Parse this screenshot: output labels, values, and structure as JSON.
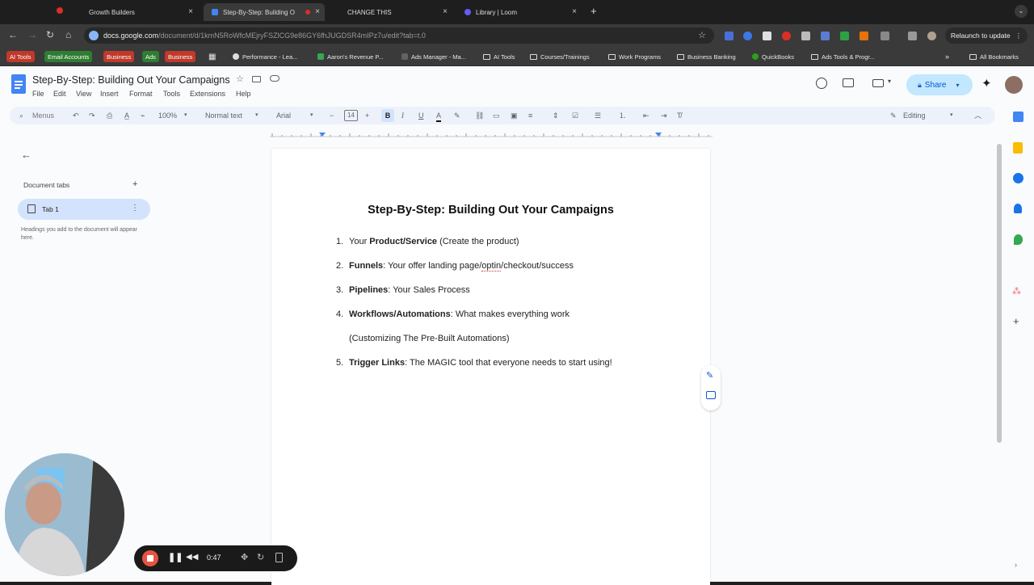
{
  "browser": {
    "tabs": [
      {
        "title": "Growth Builders",
        "active": false
      },
      {
        "title": "Step-By-Step: Building O",
        "active": true
      },
      {
        "title": "CHANGE THIS",
        "active": false
      },
      {
        "title": "Library | Loom",
        "active": false
      }
    ],
    "url_host": "docs.google.com",
    "url_path": "/document/d/1kmN5RoWfcMEjryFSZlCG9e86GY6fhJUGDSR4mIPz7u/edit?tab=t.0",
    "relaunch_label": "Relaunch to update",
    "bookmarks": [
      {
        "label": "AI Tools",
        "kind": "chip",
        "color": "#c0392b"
      },
      {
        "label": "Email Accounts",
        "kind": "chip",
        "color": "#2e7d32"
      },
      {
        "label": "Business",
        "kind": "chip",
        "color": "#c0392b"
      },
      {
        "label": "Ads",
        "kind": "chip",
        "color": "#2e7d32"
      },
      {
        "label": "Business",
        "kind": "chip",
        "color": "#c0392b"
      },
      {
        "label": "Performance - Lea...",
        "kind": "site"
      },
      {
        "label": "Aaron's Revenue P...",
        "kind": "site"
      },
      {
        "label": "Ads Manager - Ma...",
        "kind": "site"
      },
      {
        "label": "AI Tools",
        "kind": "folder"
      },
      {
        "label": "Courses/Trainings",
        "kind": "folder"
      },
      {
        "label": "Work Programs",
        "kind": "folder"
      },
      {
        "label": "Business Banking",
        "kind": "folder"
      },
      {
        "label": "QuickBooks",
        "kind": "site"
      },
      {
        "label": "Ads Tools & Progr...",
        "kind": "folder"
      },
      {
        "label": "All Bookmarks",
        "kind": "folder"
      }
    ]
  },
  "docs": {
    "title": "Step-By-Step:  Building Out Your Campaigns",
    "menu": [
      "File",
      "Edit",
      "View",
      "Insert",
      "Format",
      "Tools",
      "Extensions",
      "Help"
    ],
    "share_label": "Share",
    "editing_label": "Editing",
    "toolbar": {
      "menus_label": "Menus",
      "zoom": "100%",
      "style": "Normal text",
      "font": "Arial",
      "font_size": "14"
    },
    "sidebar": {
      "header": "Document tabs",
      "tab_label": "Tab 1",
      "hint": "Headings you add to the document will appear here."
    },
    "content": {
      "heading": "Step-By-Step:  Building Out Your Campaigns",
      "items": [
        {
          "num": "1.",
          "pre": "Your ",
          "bold": "Product/Service",
          "rest": " (Create the product)"
        },
        {
          "num": "2.",
          "pre": "",
          "bold": "Funnels",
          "rest": ": Your offer landing page/",
          "spell": "optin",
          "rest2": "/checkout/success"
        },
        {
          "num": "3.",
          "pre": "",
          "bold": "Pipelines",
          "rest": ": Your Sales Process"
        },
        {
          "num": "4.",
          "pre": "",
          "bold": "Workflows/Automations",
          "rest": ": What makes everything work"
        },
        {
          "num": "",
          "pre": "",
          "bold": "",
          "rest": "(Customizing The Pre-Built Automations)"
        },
        {
          "num": "5.",
          "pre": "",
          "bold": "Trigger Links",
          "rest": ": The MAGIC tool that everyone needs to start using!"
        }
      ]
    }
  },
  "recorder": {
    "time": "0:47"
  }
}
